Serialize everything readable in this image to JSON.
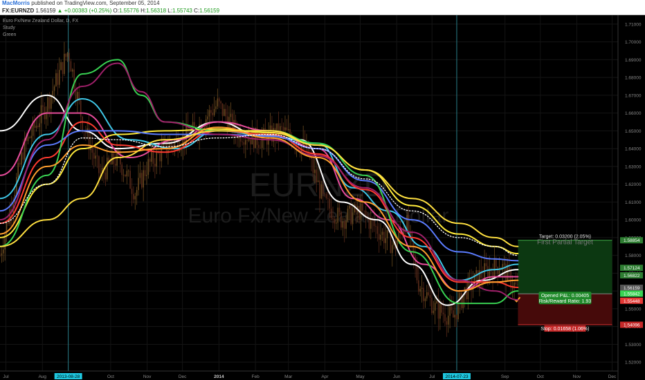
{
  "header": {
    "author": "MacMorris",
    "published_text": "published on TradingView.com, September 05, 2014"
  },
  "quote": {
    "symbol": "FX:EURNZD",
    "last": "1.56159",
    "change": "+0.00383 (+0.25%)",
    "open_label": "O:",
    "open": "1.55776",
    "high_label": "H:",
    "high": "1.56318",
    "low_label": "L:",
    "low": "1.55743",
    "close_label": "C:",
    "close": "1.56159",
    "up_arrow": "▲"
  },
  "legend": {
    "title": "Euro Fx/New Zealand Dollar, D, FX",
    "line2": "Study",
    "line3": "Green"
  },
  "watermark": {
    "ticker": "EURNZD",
    "name": "Euro Fx/New Zealand Dollar"
  },
  "chart_data": {
    "type": "line",
    "subtype": "candlestick with moving-average ribbon",
    "ylim": [
      1.515,
      1.715
    ],
    "y_ticks": [
      "1.71000",
      "1.70000",
      "1.69000",
      "1.68000",
      "1.67000",
      "1.66000",
      "1.65000",
      "1.64000",
      "1.63000",
      "1.62000",
      "1.61000",
      "1.60000",
      "1.59000",
      "1.58000",
      "1.57000",
      "1.56000",
      "1.55000",
      "1.54000",
      "1.53000",
      "1.52000"
    ],
    "y_tick_values": [
      1.71,
      1.7,
      1.69,
      1.68,
      1.67,
      1.66,
      1.65,
      1.64,
      1.63,
      1.62,
      1.61,
      1.6,
      1.59,
      1.58,
      1.57,
      1.56,
      1.55,
      1.54,
      1.53,
      1.52
    ],
    "x_ticks": [
      {
        "label": "Jul",
        "bold": false
      },
      {
        "label": "Aug",
        "bold": false
      },
      {
        "label": "Oct",
        "bold": false
      },
      {
        "label": "Nov",
        "bold": false
      },
      {
        "label": "Dec",
        "bold": false
      },
      {
        "label": "2014",
        "bold": true
      },
      {
        "label": "Feb",
        "bold": false
      },
      {
        "label": "Mar",
        "bold": false
      },
      {
        "label": "Apr",
        "bold": false
      },
      {
        "label": "May",
        "bold": false
      },
      {
        "label": "Jun",
        "bold": false
      },
      {
        "label": "Jul",
        "bold": false
      },
      {
        "label": "Sep",
        "bold": false
      },
      {
        "label": "Oct",
        "bold": false
      },
      {
        "label": "Nov",
        "bold": false
      },
      {
        "label": "Dec",
        "bold": false
      }
    ],
    "x_tick_days": [
      5,
      36,
      94,
      125,
      155,
      186,
      217,
      245,
      276,
      306,
      337,
      367,
      429,
      459,
      490,
      520
    ],
    "date_markers": [
      {
        "label": "2013-08-28",
        "day": 58
      },
      {
        "label": "2014-07-23",
        "day": 388
      }
    ],
    "price_path": [
      [
        0,
        1.58
      ],
      [
        20,
        1.64
      ],
      [
        40,
        1.665
      ],
      [
        58,
        1.695
      ],
      [
        70,
        1.655
      ],
      [
        85,
        1.625
      ],
      [
        100,
        1.635
      ],
      [
        115,
        1.615
      ],
      [
        125,
        1.63
      ],
      [
        140,
        1.64
      ],
      [
        165,
        1.65
      ],
      [
        185,
        1.665
      ],
      [
        200,
        1.65
      ],
      [
        220,
        1.645
      ],
      [
        240,
        1.65
      ],
      [
        260,
        1.64
      ],
      [
        275,
        1.61
      ],
      [
        290,
        1.6
      ],
      [
        305,
        1.605
      ],
      [
        320,
        1.595
      ],
      [
        335,
        1.585
      ],
      [
        345,
        1.6
      ],
      [
        355,
        1.565
      ],
      [
        370,
        1.55
      ],
      [
        385,
        1.545
      ],
      [
        395,
        1.56
      ],
      [
        410,
        1.57
      ],
      [
        425,
        1.575
      ],
      [
        440,
        1.56
      ]
    ],
    "ma_ribbon": [
      {
        "color": "#ffffff",
        "pts": [
          [
            0,
            1.65
          ],
          [
            40,
            1.67
          ],
          [
            70,
            1.65
          ],
          [
            100,
            1.64
          ],
          [
            140,
            1.643
          ],
          [
            185,
            1.655
          ],
          [
            220,
            1.648
          ],
          [
            255,
            1.645
          ],
          [
            290,
            1.61
          ],
          [
            320,
            1.6
          ],
          [
            350,
            1.575
          ],
          [
            380,
            1.552
          ],
          [
            410,
            1.566
          ],
          [
            440,
            1.572
          ]
        ]
      },
      {
        "color": "#e84c9c",
        "pts": [
          [
            0,
            1.625
          ],
          [
            40,
            1.66
          ],
          [
            70,
            1.66
          ],
          [
            110,
            1.635
          ],
          [
            150,
            1.645
          ],
          [
            185,
            1.655
          ],
          [
            230,
            1.65
          ],
          [
            270,
            1.64
          ],
          [
            300,
            1.612
          ],
          [
            330,
            1.6
          ],
          [
            360,
            1.575
          ],
          [
            390,
            1.56
          ],
          [
            420,
            1.568
          ],
          [
            440,
            1.568
          ]
        ]
      },
      {
        "color": "#3fc8e8",
        "pts": [
          [
            0,
            1.612
          ],
          [
            40,
            1.648
          ],
          [
            70,
            1.668
          ],
          [
            110,
            1.645
          ],
          [
            150,
            1.64
          ],
          [
            185,
            1.65
          ],
          [
            230,
            1.647
          ],
          [
            270,
            1.643
          ],
          [
            300,
            1.618
          ],
          [
            330,
            1.605
          ],
          [
            360,
            1.585
          ],
          [
            390,
            1.566
          ],
          [
            420,
            1.572
          ],
          [
            440,
            1.575
          ]
        ]
      },
      {
        "color": "#ffeb3b",
        "pts": [
          [
            0,
            1.59
          ],
          [
            40,
            1.62
          ],
          [
            70,
            1.64
          ],
          [
            100,
            1.648
          ],
          [
            140,
            1.65
          ],
          [
            185,
            1.651
          ],
          [
            230,
            1.649
          ],
          [
            270,
            1.642
          ],
          [
            310,
            1.628
          ],
          [
            350,
            1.608
          ],
          [
            390,
            1.592
          ],
          [
            420,
            1.585
          ],
          [
            440,
            1.581
          ]
        ]
      },
      {
        "color": "#ff3b30",
        "pts": [
          [
            0,
            1.598
          ],
          [
            40,
            1.635
          ],
          [
            70,
            1.655
          ],
          [
            100,
            1.642
          ],
          [
            140,
            1.638
          ],
          [
            185,
            1.65
          ],
          [
            230,
            1.648
          ],
          [
            270,
            1.637
          ],
          [
            310,
            1.617
          ],
          [
            350,
            1.59
          ],
          [
            390,
            1.565
          ],
          [
            420,
            1.565
          ],
          [
            440,
            1.562
          ]
        ]
      },
      {
        "color": "#5b7cff",
        "pts": [
          [
            0,
            1.605
          ],
          [
            40,
            1.642
          ],
          [
            70,
            1.65
          ],
          [
            100,
            1.65
          ],
          [
            140,
            1.648
          ],
          [
            185,
            1.648
          ],
          [
            230,
            1.647
          ],
          [
            270,
            1.64
          ],
          [
            310,
            1.622
          ],
          [
            350,
            1.6
          ],
          [
            390,
            1.582
          ],
          [
            420,
            1.578
          ],
          [
            440,
            1.577
          ]
        ]
      },
      {
        "color": "#39d353",
        "pts": [
          [
            0,
            1.585
          ],
          [
            40,
            1.625
          ],
          [
            70,
            1.682
          ],
          [
            100,
            1.69
          ],
          [
            120,
            1.67
          ],
          [
            140,
            1.655
          ],
          [
            185,
            1.65
          ],
          [
            230,
            1.65
          ],
          [
            270,
            1.643
          ],
          [
            310,
            1.625
          ],
          [
            350,
            1.582
          ],
          [
            390,
            1.553
          ],
          [
            420,
            1.553
          ],
          [
            440,
            1.56
          ]
        ]
      },
      {
        "color": "#a0206a",
        "pts": [
          [
            0,
            1.6
          ],
          [
            40,
            1.645
          ],
          [
            70,
            1.675
          ],
          [
            100,
            1.688
          ],
          [
            120,
            1.672
          ],
          [
            140,
            1.655
          ],
          [
            185,
            1.648
          ],
          [
            230,
            1.645
          ],
          [
            270,
            1.636
          ],
          [
            310,
            1.618
          ],
          [
            350,
            1.593
          ],
          [
            390,
            1.566
          ],
          [
            420,
            1.56
          ],
          [
            440,
            1.555
          ]
        ]
      },
      {
        "color": "#ff9f2e",
        "pts": [
          [
            0,
            1.592
          ],
          [
            40,
            1.63
          ],
          [
            70,
            1.642
          ],
          [
            100,
            1.638
          ],
          [
            140,
            1.64
          ],
          [
            185,
            1.652
          ],
          [
            230,
            1.646
          ],
          [
            270,
            1.635
          ],
          [
            310,
            1.61
          ],
          [
            350,
            1.585
          ],
          [
            390,
            1.56
          ],
          [
            420,
            1.565
          ],
          [
            440,
            1.566
          ]
        ]
      },
      {
        "color": "#ffe040",
        "pts": [
          [
            0,
            1.585
          ],
          [
            40,
            1.6
          ],
          [
            70,
            1.612
          ],
          [
            100,
            1.635
          ],
          [
            140,
            1.645
          ],
          [
            185,
            1.65
          ],
          [
            230,
            1.65
          ],
          [
            270,
            1.642
          ],
          [
            310,
            1.628
          ],
          [
            350,
            1.612
          ],
          [
            390,
            1.598
          ],
          [
            420,
            1.59
          ],
          [
            440,
            1.585
          ]
        ]
      },
      {
        "color": "#ffffff",
        "dotted": true,
        "pts": [
          [
            0,
            1.598
          ],
          [
            40,
            1.62
          ],
          [
            70,
            1.646
          ],
          [
            100,
            1.645
          ],
          [
            140,
            1.641
          ],
          [
            185,
            1.646
          ],
          [
            230,
            1.648
          ],
          [
            270,
            1.64
          ],
          [
            310,
            1.623
          ],
          [
            350,
            1.605
          ],
          [
            390,
            1.59
          ],
          [
            420,
            1.585
          ],
          [
            440,
            1.58
          ]
        ]
      }
    ],
    "axis_price_tags": [
      {
        "value": "1.58854",
        "price": 1.5885,
        "color": "#2e7d32"
      },
      {
        "value": "1.57124",
        "price": 1.573,
        "color": "#2e7d32"
      },
      {
        "value": "1.56822",
        "price": 1.5688,
        "color": "#2e7d32"
      },
      {
        "value": "1.56159",
        "price": 1.5618,
        "color": "#555555"
      },
      {
        "value": "1.55842",
        "price": 1.5585,
        "color": "#39d353"
      },
      {
        "value": "1.55448",
        "price": 1.5545,
        "color": "#e53935"
      },
      {
        "value": "1.54096",
        "price": 1.541,
        "color": "#c62828"
      }
    ],
    "position": {
      "entry_price": 1.5584,
      "target_price": 1.5885,
      "stop_price": 1.541,
      "start_day": 440,
      "end_day": 520,
      "target_label": "Target: 0.03200 (2.05%)",
      "target_note": "First Partial Target",
      "opened_pnl": "Opened P&L: 0.00405",
      "risk_reward": "Risk/Reward Ratio: 1.93",
      "stop_label": "Stop: 0.01658 (1.06%)"
    },
    "x_range_days": [
      0,
      525
    ]
  }
}
